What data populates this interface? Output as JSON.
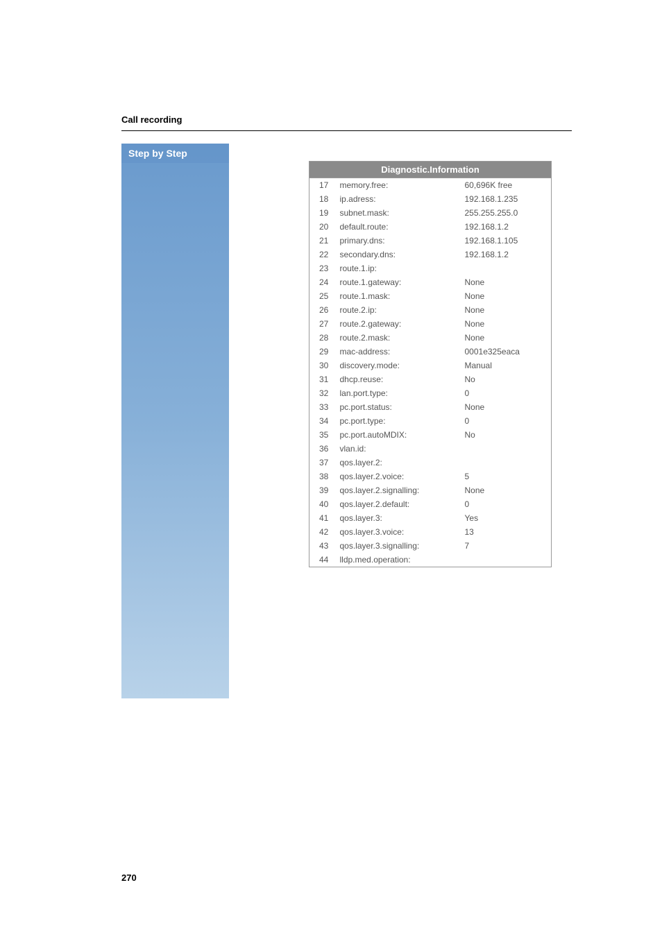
{
  "section_title": "Call recording",
  "sidebar_label": "Step by Step",
  "table_header": "Diagnostic.Information",
  "rows": [
    {
      "n": "17",
      "label": "memory.free:",
      "value": "60,696K free"
    },
    {
      "n": "18",
      "label": "ip.adress:",
      "value": "192.168.1.235"
    },
    {
      "n": "19",
      "label": "subnet.mask:",
      "value": "255.255.255.0"
    },
    {
      "n": "20",
      "label": "default.route:",
      "value": "192.168.1.2"
    },
    {
      "n": "21",
      "label": "primary.dns:",
      "value": "192.168.1.105"
    },
    {
      "n": "22",
      "label": "secondary.dns:",
      "value": "192.168.1.2"
    },
    {
      "n": "23",
      "label": "route.1.ip:",
      "value": ""
    },
    {
      "n": "24",
      "label": "route.1.gateway:",
      "value": "None"
    },
    {
      "n": "25",
      "label": "route.1.mask:",
      "value": "None"
    },
    {
      "n": "26",
      "label": "route.2.ip:",
      "value": "None"
    },
    {
      "n": "27",
      "label": "route.2.gateway:",
      "value": "None"
    },
    {
      "n": "28",
      "label": "route.2.mask:",
      "value": "None"
    },
    {
      "n": "29",
      "label": "mac-address:",
      "value": "0001e325eaca"
    },
    {
      "n": "30",
      "label": "discovery.mode:",
      "value": "Manual"
    },
    {
      "n": "31",
      "label": "dhcp.reuse:",
      "value": "No"
    },
    {
      "n": "32",
      "label": "lan.port.type:",
      "value": "0"
    },
    {
      "n": "33",
      "label": "pc.port.status:",
      "value": "None"
    },
    {
      "n": "34",
      "label": "pc.port.type:",
      "value": "0"
    },
    {
      "n": "35",
      "label": "pc.port.autoMDIX:",
      "value": "No"
    },
    {
      "n": "36",
      "label": "vlan.id:",
      "value": ""
    },
    {
      "n": "37",
      "label": "qos.layer.2:",
      "value": ""
    },
    {
      "n": "38",
      "label": "qos.layer.2.voice:",
      "value": "5"
    },
    {
      "n": "39",
      "label": "qos.layer.2.signalling:",
      "value": "None"
    },
    {
      "n": "40",
      "label": "qos.layer.2.default:",
      "value": "0"
    },
    {
      "n": "41",
      "label": "qos.layer.3:",
      "value": "Yes"
    },
    {
      "n": "42",
      "label": "qos.layer.3.voice:",
      "value": "13"
    },
    {
      "n": "43",
      "label": "qos.layer.3.signalling:",
      "value": "7"
    },
    {
      "n": "44",
      "label": "lldp.med.operation:",
      "value": ""
    }
  ],
  "page_number": "270"
}
